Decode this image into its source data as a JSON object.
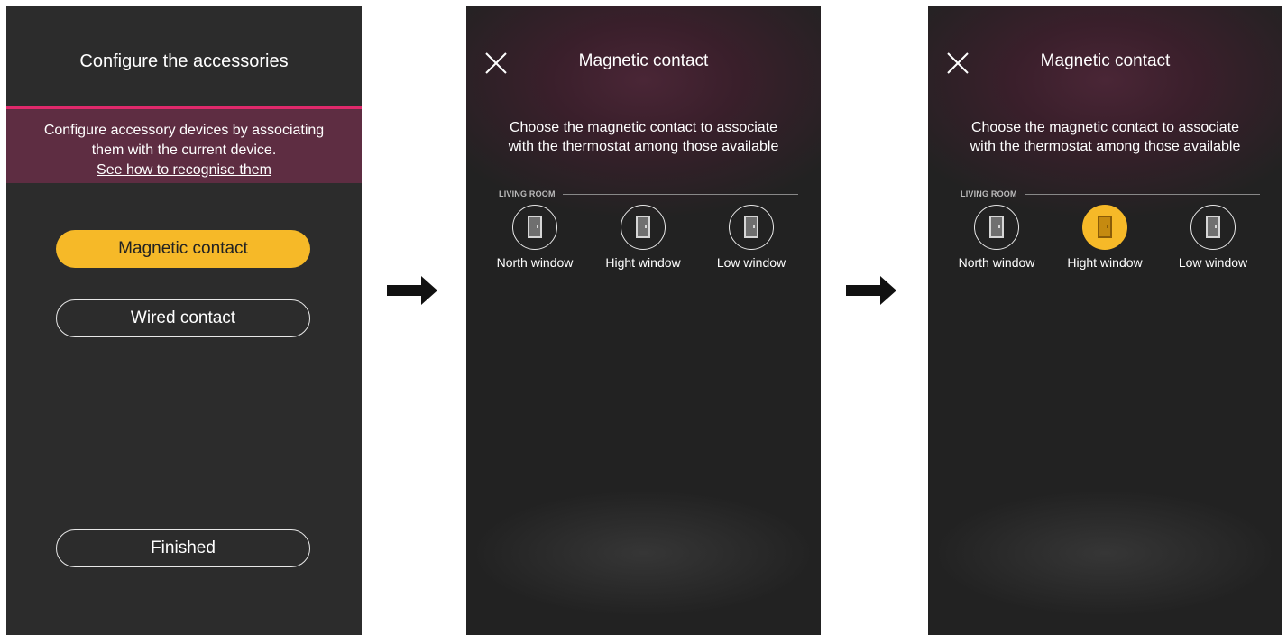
{
  "screen1": {
    "title": "Configure the accessories",
    "banner_line1": "Configure accessory devices by associating",
    "banner_line2": "them with the current device.",
    "banner_link": "See how to recognise them",
    "magnetic_label": "Magnetic contact",
    "wired_label": "Wired contact",
    "finished_label": "Finished"
  },
  "screen2": {
    "title": "Magnetic contact",
    "desc_line1": "Choose the magnetic contact to associate",
    "desc_line2": "with the thermostat among those available",
    "room": "LIVING ROOM",
    "devices": [
      {
        "label": "North window",
        "selected": false
      },
      {
        "label": "Hight window",
        "selected": false
      },
      {
        "label": "Low window",
        "selected": false
      }
    ]
  },
  "screen3": {
    "title": "Magnetic contact",
    "desc_line1": "Choose the magnetic contact to associate",
    "desc_line2": "with the thermostat among those available",
    "room": "LIVING ROOM",
    "devices": [
      {
        "label": "North window",
        "selected": false
      },
      {
        "label": "Hight window",
        "selected": true
      },
      {
        "label": "Low window",
        "selected": false
      }
    ]
  },
  "colors": {
    "accent": "#f6b928",
    "magenta_line": "#e0296b",
    "banner": "#5e2d42",
    "screen_bg": "#2c2c2c"
  },
  "icons": [
    "close-icon",
    "door-icon",
    "right-arrow-icon"
  ]
}
